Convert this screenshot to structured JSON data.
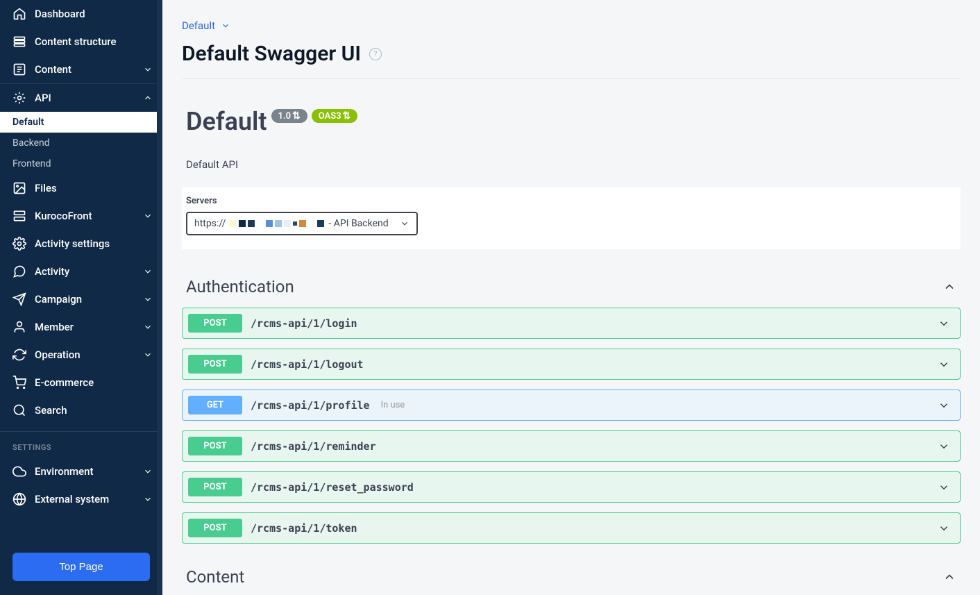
{
  "sidebar": {
    "dashboard": "Dashboard",
    "content_structure": "Content structure",
    "content": "Content",
    "api": "API",
    "api_default": "Default",
    "api_backend": "Backend",
    "api_frontend": "Frontend",
    "files": "Files",
    "kurocofront": "KurocoFront",
    "activity_settings": "Activity settings",
    "activity": "Activity",
    "campaign": "Campaign",
    "member": "Member",
    "operation": "Operation",
    "ecommerce": "E-commerce",
    "search": "Search",
    "settings_heading": "SETTINGS",
    "environment": "Environment",
    "external_system": "External system",
    "top_page": "Top Page"
  },
  "breadcrumb": {
    "default": "Default"
  },
  "page_title": "Default Swagger UI",
  "swagger": {
    "title": "Default",
    "version": "1.0",
    "oas": "OAS3",
    "desc": "Default API",
    "servers_label": "Servers",
    "server_prefix": "https://",
    "server_suffix": "- API Backend"
  },
  "sections": {
    "authentication": "Authentication",
    "content": "Content"
  },
  "endpoints": [
    {
      "method": "POST",
      "path": "/rcms-api/1/login"
    },
    {
      "method": "POST",
      "path": "/rcms-api/1/logout"
    },
    {
      "method": "GET",
      "path": "/rcms-api/1/profile",
      "tag": "In use"
    },
    {
      "method": "POST",
      "path": "/rcms-api/1/reminder"
    },
    {
      "method": "POST",
      "path": "/rcms-api/1/reset_password"
    },
    {
      "method": "POST",
      "path": "/rcms-api/1/token"
    }
  ]
}
